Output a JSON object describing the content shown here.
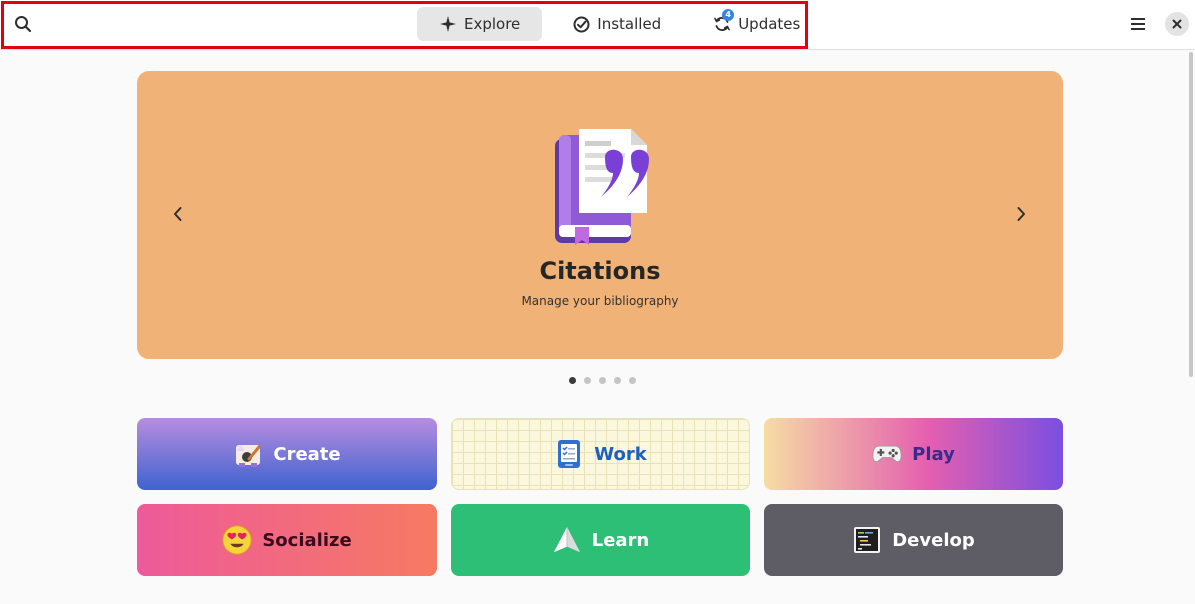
{
  "header": {
    "tabs": [
      {
        "label": "Explore",
        "icon": "explore-icon",
        "active": true
      },
      {
        "label": "Installed",
        "icon": "installed-check-icon",
        "active": false
      },
      {
        "label": "Updates",
        "icon": "updates-icon",
        "active": false,
        "badge": "4"
      }
    ],
    "search_icon": "search-icon",
    "menu_icon": "hamburger-menu-icon",
    "close_icon": "close-icon"
  },
  "featured": {
    "app_name": "Citations",
    "summary": "Manage your bibliography",
    "background_color": "#f0b277",
    "slide_count": 5,
    "active_slide": 1
  },
  "categories": [
    {
      "label": "Create",
      "icon": "create-art-icon"
    },
    {
      "label": "Work",
      "icon": "work-checklist-icon"
    },
    {
      "label": "Play",
      "icon": "gamepad-icon"
    },
    {
      "label": "Socialize",
      "icon": "heart-eyes-emoji-icon"
    },
    {
      "label": "Learn",
      "icon": "paper-plane-icon"
    },
    {
      "label": "Develop",
      "icon": "terminal-icon"
    }
  ],
  "colors": {
    "accent": "#3584e4",
    "highlight_border": "#e0000f"
  }
}
